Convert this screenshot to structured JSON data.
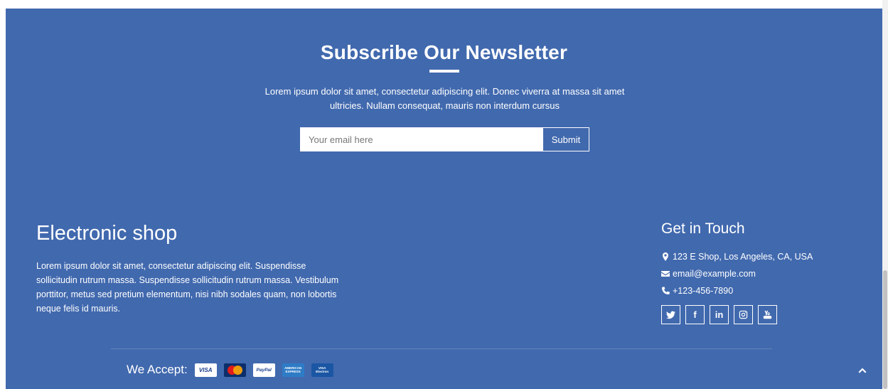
{
  "newsletter": {
    "title": "Subscribe Our Newsletter",
    "description": "Lorem ipsum dolor sit amet, consectetur adipiscing elit. Donec viverra at massa sit amet ultricies. Nullam consequat, mauris non interdum cursus",
    "email_placeholder": "Your email here",
    "email_value": "",
    "submit_label": "Submit"
  },
  "about": {
    "title": "Electronic shop",
    "text": "Lorem ipsum dolor sit amet, consectetur adipiscing elit. Suspendisse sollicitudin rutrum massa. Suspendisse sollicitudin rutrum massa. Vestibulum porttitor, metus sed pretium elementum, nisi nibh sodales quam, non lobortis neque felis id mauris."
  },
  "contact": {
    "title": "Get in Touch",
    "address": "123 E Shop, Los Angeles, CA, USA",
    "email": "email@example.com",
    "phone": "+123-456-7890",
    "socials": [
      {
        "icon": "twitter-icon"
      },
      {
        "icon": "facebook-icon",
        "glyph": "f"
      },
      {
        "icon": "linkedin-icon",
        "glyph": "in"
      },
      {
        "icon": "instagram-icon"
      },
      {
        "icon": "youtube-icon"
      }
    ]
  },
  "payments": {
    "label": "We Accept:",
    "cards": [
      {
        "icon": "visa-card-icon",
        "text": "VISA"
      },
      {
        "icon": "mastercard-card-icon",
        "text": "MasterCard"
      },
      {
        "icon": "paypal-card-icon",
        "text": "PayPal"
      },
      {
        "icon": "amex-card-icon",
        "text": "AMERICAN EXPRESS"
      },
      {
        "icon": "visa-electron-card-icon",
        "text": "VISA Electron"
      }
    ]
  },
  "colors": {
    "background": "#4169ae",
    "text": "#ffffff"
  }
}
